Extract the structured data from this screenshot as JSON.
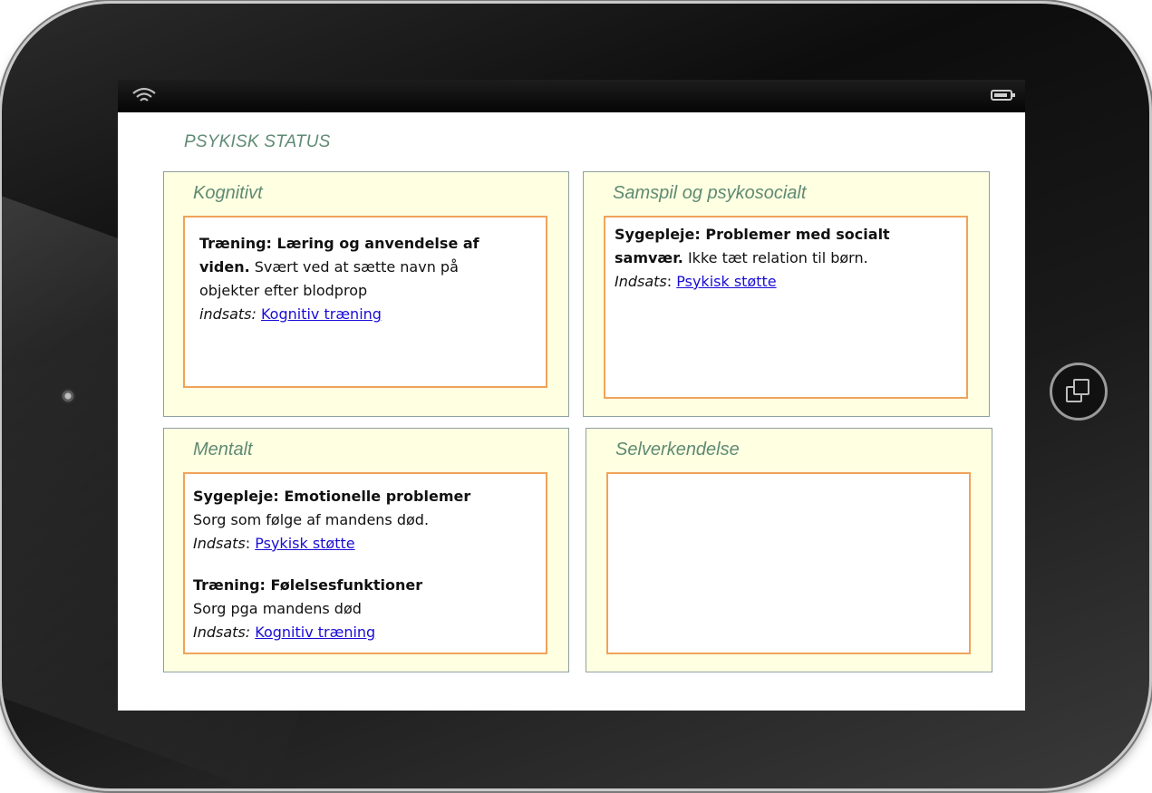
{
  "title": "PSYKISK STATUS",
  "device": {
    "wifi_icon": "wifi-icon",
    "battery_icon": "battery-icon",
    "home_icon": "home-button-icon"
  },
  "colors": {
    "title": "#5f8a74",
    "panel_bg": "#ffffe1",
    "inner_border": "#f0a35a",
    "link": "#1a0dd6"
  },
  "panels": {
    "kognitivt": {
      "title": "Kognitivt",
      "entry": {
        "heading_l1": "Træning: Læring og anvendelse af",
        "heading_l2": "viden.",
        "text_l1": " Svært ved at sætte navn på",
        "text_l2": "objekter efter blodprop",
        "effort_label": "indsats:",
        "effort_link": "Kognitiv træning"
      }
    },
    "samspil": {
      "title": "Samspil og psykosocialt",
      "entry": {
        "heading_l1": "Sygepleje: Problemer med socialt",
        "heading_l2": "samvær.",
        "text_l1": " Ikke tæt relation til børn.",
        "effort_label": "Indsats",
        "effort_sep": ": ",
        "effort_link": "Psykisk støtte"
      }
    },
    "mentalt": {
      "title": "Mentalt",
      "entries": [
        {
          "heading": "Sygepleje: Emotionelle problemer",
          "text": "Sorg som følge af mandens død.",
          "effort_label": "Indsats",
          "effort_sep": ": ",
          "effort_link": "Psykisk støtte"
        },
        {
          "heading": "Træning: Følelsesfunktioner",
          "text": "Sorg pga mandens død",
          "effort_label": "Indsats:",
          "effort_sep": " ",
          "effort_link": "Kognitiv træning"
        }
      ]
    },
    "selverkendelse": {
      "title": "Selverkendelse"
    }
  }
}
